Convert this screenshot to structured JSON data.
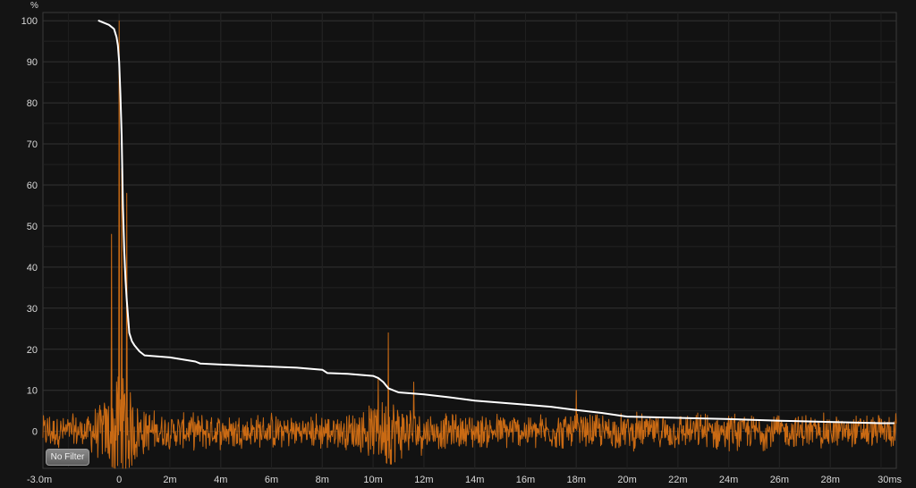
{
  "chart_data": {
    "type": "line",
    "ylabel": "%",
    "xlim": [
      -3.0,
      30.6
    ],
    "ylim": [
      -9,
      102
    ],
    "grid": true,
    "x_ticks": [
      {
        "value": -3,
        "label": "-3.0m"
      },
      {
        "value": 0,
        "label": "0"
      },
      {
        "value": 2,
        "label": "2m"
      },
      {
        "value": 4,
        "label": "4m"
      },
      {
        "value": 6,
        "label": "6m"
      },
      {
        "value": 8,
        "label": "8m"
      },
      {
        "value": 10,
        "label": "10m"
      },
      {
        "value": 12,
        "label": "12m"
      },
      {
        "value": 14,
        "label": "14m"
      },
      {
        "value": 16,
        "label": "16m"
      },
      {
        "value": 18,
        "label": "18m"
      },
      {
        "value": 20,
        "label": "20m"
      },
      {
        "value": 22,
        "label": "22m"
      },
      {
        "value": 24,
        "label": "24m"
      },
      {
        "value": 26,
        "label": "26m"
      },
      {
        "value": 28,
        "label": "28m"
      },
      {
        "value": 30,
        "label": "30ms"
      }
    ],
    "y_ticks": [
      {
        "value": 0,
        "label": "0"
      },
      {
        "value": 10,
        "label": "10"
      },
      {
        "value": 20,
        "label": "20"
      },
      {
        "value": 30,
        "label": "30"
      },
      {
        "value": 40,
        "label": "40"
      },
      {
        "value": 50,
        "label": "50"
      },
      {
        "value": 60,
        "label": "60"
      },
      {
        "value": 70,
        "label": "70"
      },
      {
        "value": 80,
        "label": "80"
      },
      {
        "value": 90,
        "label": "90"
      },
      {
        "value": 100,
        "label": "100"
      }
    ],
    "series": [
      {
        "color": "#ffffff",
        "x": [
          -0.8,
          -0.4,
          -0.2,
          -0.1,
          -0.05,
          0.0,
          0.05,
          0.1,
          0.15,
          0.2,
          0.25,
          0.3,
          0.35,
          0.4,
          0.5,
          0.6,
          0.8,
          1.0,
          2.0,
          3.0,
          3.2,
          5.0,
          7.0,
          8.0,
          8.2,
          9.0,
          10.0,
          10.2,
          10.4,
          10.6,
          11.0,
          12.0,
          13.0,
          14.0,
          15.0,
          16.0,
          17.0,
          18.0,
          19.0,
          20.0,
          22.0,
          24.0,
          26.0,
          28.0,
          30.0,
          30.5
        ],
        "values": [
          100,
          99,
          98,
          96,
          94,
          90,
          82,
          72,
          55,
          44,
          37,
          32,
          28,
          24,
          22,
          21,
          19.5,
          18.5,
          18,
          17,
          16.5,
          16,
          15.5,
          15,
          14.2,
          14,
          13.5,
          13,
          12,
          10.5,
          9.5,
          9,
          8.3,
          7.5,
          7,
          6.5,
          6,
          5.2,
          4.5,
          3.6,
          3.3,
          3.0,
          2.6,
          2.3,
          2.0,
          2.0
        ]
      },
      {
        "color": "#c96a14",
        "peaks": [
          {
            "x": 0.0,
            "value": 100
          },
          {
            "x": 0.1,
            "value": 64
          },
          {
            "x": -0.3,
            "value": 48
          },
          {
            "x": 0.3,
            "value": 58
          },
          {
            "x": 10.6,
            "value": 24
          },
          {
            "x": 10.2,
            "value": 13
          },
          {
            "x": 11.6,
            "value": 12
          },
          {
            "x": 18.0,
            "value": 10
          }
        ],
        "noise_floor": 3.5
      }
    ]
  },
  "controls": {
    "filter_label": "No Filter"
  }
}
